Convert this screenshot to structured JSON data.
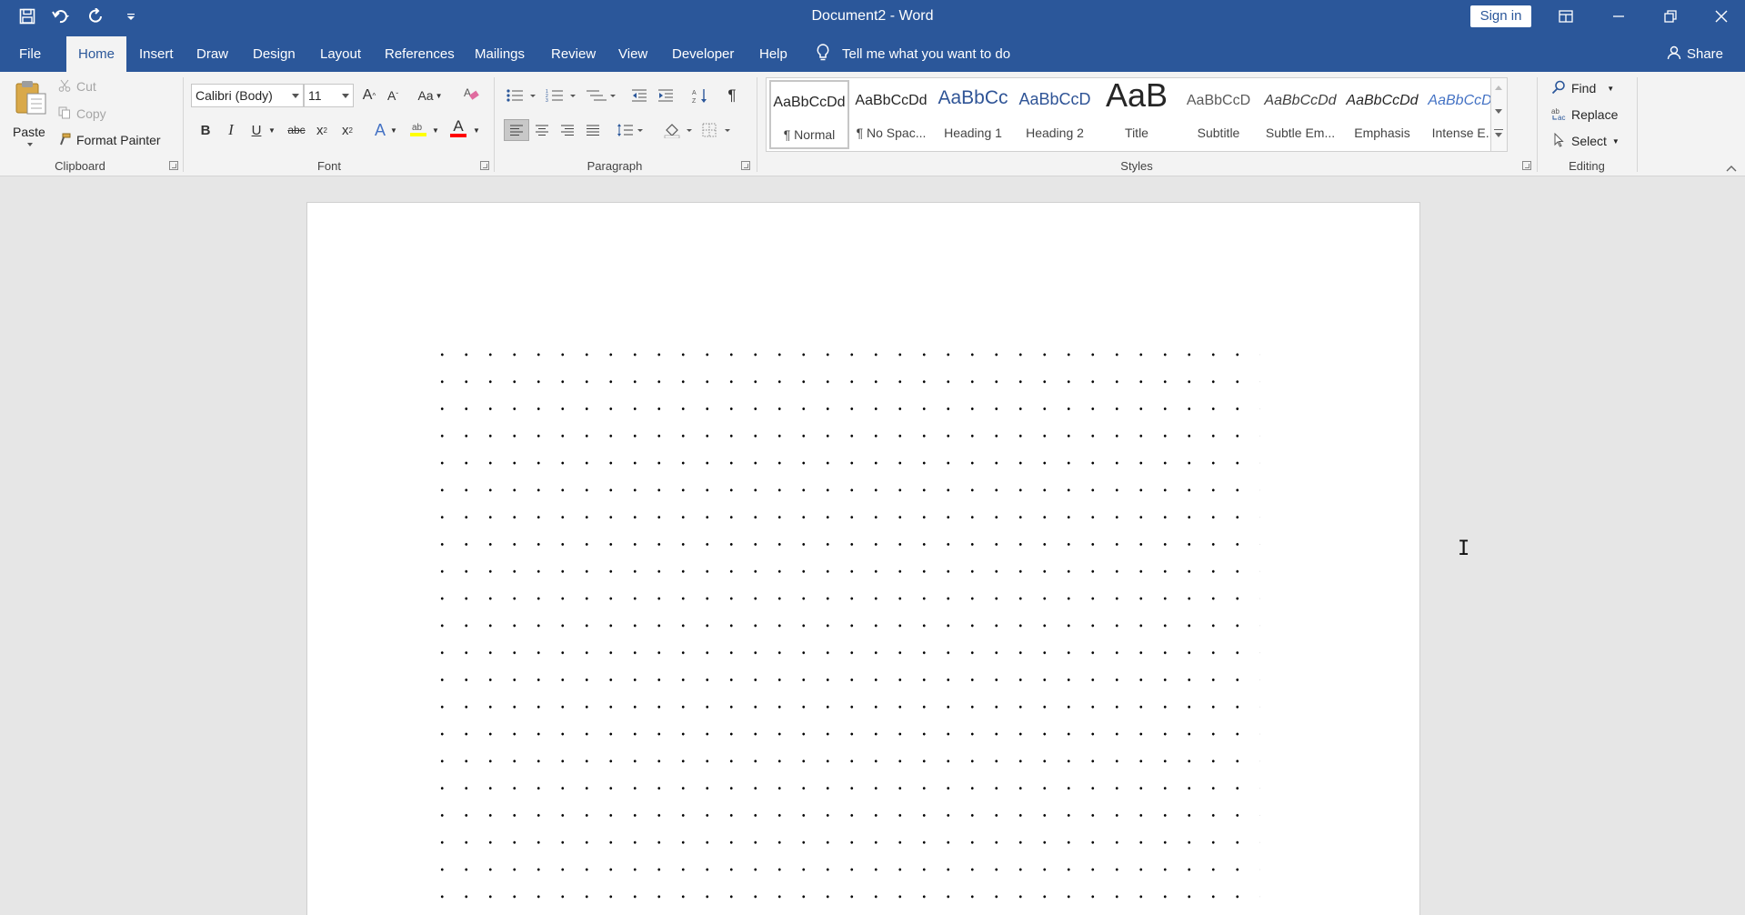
{
  "window": {
    "title": "Document2  -  Word",
    "sign_in": "Sign in"
  },
  "quick_access": [
    "save-icon",
    "undo-icon",
    "redo-icon",
    "customize-qat-icon"
  ],
  "tabs": [
    {
      "label": "File"
    },
    {
      "label": "Home",
      "active": true
    },
    {
      "label": "Insert"
    },
    {
      "label": "Draw"
    },
    {
      "label": "Design"
    },
    {
      "label": "Layout"
    },
    {
      "label": "References"
    },
    {
      "label": "Mailings"
    },
    {
      "label": "Review"
    },
    {
      "label": "View"
    },
    {
      "label": "Developer"
    },
    {
      "label": "Help"
    }
  ],
  "tell_me": "Tell me what you want to do",
  "share": "Share",
  "clipboard": {
    "group": "Clipboard",
    "paste": "Paste",
    "cut": "Cut",
    "copy": "Copy",
    "format_painter": "Format Painter"
  },
  "font": {
    "group": "Font",
    "family": "Calibri (Body)",
    "size": "11",
    "grow": "A",
    "shrink": "A",
    "change_case": "Aa",
    "bold": "B",
    "italic": "I",
    "underline": "U",
    "strike": "abc",
    "subscript": "x",
    "superscript": "x",
    "font_color": "A",
    "text_effects": "A",
    "highlight_color": "#ffff00",
    "font_color_value": "#ff0000"
  },
  "paragraph": {
    "group": "Paragraph",
    "pilcrow": "¶"
  },
  "styles": {
    "group": "Styles",
    "items": [
      {
        "sample": "AaBbCcDd",
        "name": "¶ Normal"
      },
      {
        "sample": "AaBbCcDd",
        "name": "¶ No Spac..."
      },
      {
        "sample": "AaBbCc",
        "name": "Heading 1"
      },
      {
        "sample": "AaBbCcD",
        "name": "Heading 2"
      },
      {
        "sample": "AaB",
        "name": "Title"
      },
      {
        "sample": "AaBbCcD",
        "name": "Subtitle"
      },
      {
        "sample": "AaBbCcDd",
        "name": "Subtle Em..."
      },
      {
        "sample": "AaBbCcDd",
        "name": "Emphasis"
      },
      {
        "sample": "AaBbCcDd",
        "name": "Intense E..."
      }
    ]
  },
  "editing": {
    "group": "Editing",
    "find": "Find",
    "replace": "Replace",
    "select": "Select"
  },
  "cursor": "I"
}
